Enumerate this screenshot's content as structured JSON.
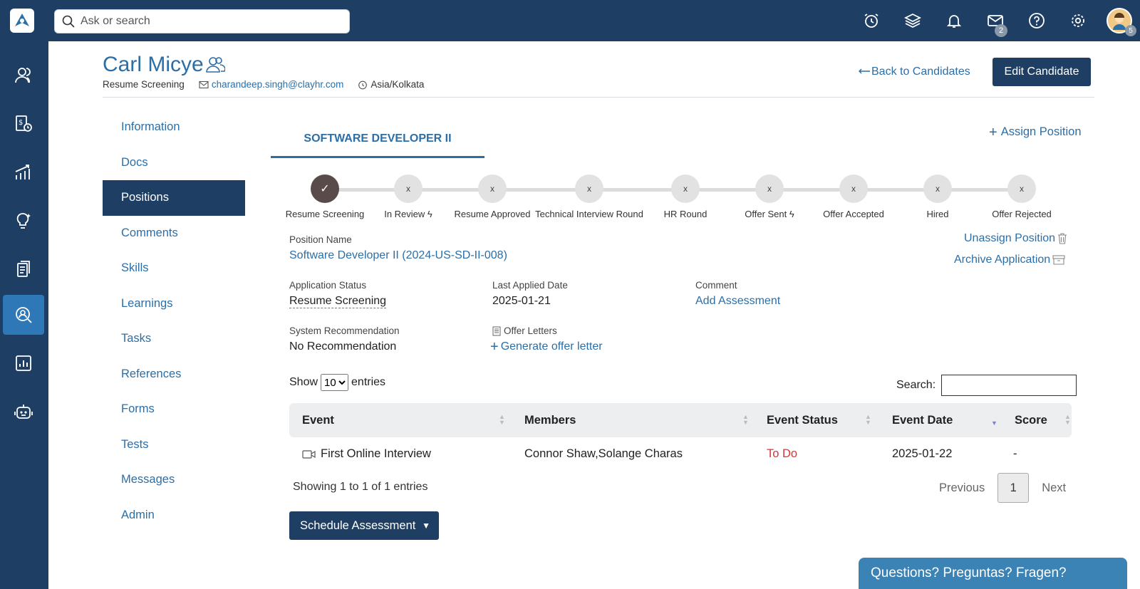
{
  "search": {
    "placeholder": "Ask or search"
  },
  "topbar": {
    "mail_badge": "2",
    "avatar_badge": "5"
  },
  "candidate": {
    "name": "Carl Micye",
    "stage": "Resume Screening",
    "email": "charandeep.singh@clayhr.com",
    "timezone": "Asia/Kolkata"
  },
  "header": {
    "back_label": "Back to Candidates",
    "edit_label": "Edit Candidate"
  },
  "sidemenu": [
    "Information",
    "Docs",
    "Positions",
    "Comments",
    "Skills",
    "Learnings",
    "Tasks",
    "References",
    "Forms",
    "Tests",
    "Messages",
    "Admin"
  ],
  "tab": {
    "label": "SOFTWARE DEVELOPER II"
  },
  "assign_position": "Assign Position",
  "stepper": {
    "done_mark": "✓",
    "pending_mark": "x",
    "steps": [
      "Resume Screening",
      "In Review",
      "Resume Approved",
      "Technical Interview Round",
      "HR Round",
      "Offer Sent",
      "Offer Accepted",
      "Hired",
      "Offer Rejected"
    ]
  },
  "details": {
    "position_name_label": "Position Name",
    "position_name": "Software Developer II (2024-US-SD-II-008)",
    "unassign": "Unassign Position",
    "archive": "Archive Application",
    "app_status_label": "Application Status",
    "app_status": "Resume Screening",
    "last_applied_label": "Last Applied Date",
    "last_applied": "2025-01-21",
    "comment_label": "Comment",
    "add_assessment": "Add Assessment",
    "sys_rec_label": "System Recommendation",
    "sys_rec": "No Recommendation",
    "offer_letters_label": "Offer Letters",
    "generate_offer": "Generate offer letter"
  },
  "table": {
    "show": "Show",
    "entries_value": "10",
    "entries": "entries",
    "search_label": "Search:",
    "columns": [
      "Event",
      "Members",
      "Event Status",
      "Event Date",
      "Score"
    ],
    "rows": [
      {
        "event": "First Online Interview",
        "members": "Connor Shaw,Solange Charas",
        "status": "To Do",
        "date": "2025-01-22",
        "score": "-"
      }
    ],
    "showing": "Showing 1 to 1 of 1 entries",
    "previous": "Previous",
    "page": "1",
    "next": "Next"
  },
  "schedule_btn": "Schedule Assessment",
  "help_widget": "Questions? Preguntas? Fragen?",
  "colors": {
    "navy": "#1e3f63",
    "link": "#2c6ea6",
    "todo": "#e03131",
    "active_nav": "#2f78b7"
  }
}
